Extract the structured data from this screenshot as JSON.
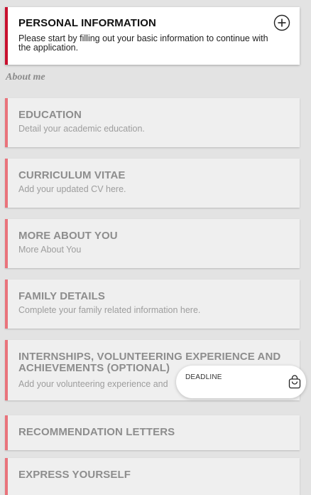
{
  "personal_info": {
    "title": "PERSONAL INFORMATION",
    "description": "Please start by filling out your basic information to continue with the application.",
    "expand_icon": "plus-circle-icon"
  },
  "section_label": "About me",
  "sections": [
    {
      "title": "EDUCATION",
      "description": "Detail your academic education."
    },
    {
      "title": "CURRICULUM VITAE",
      "description": "Add your updated CV here."
    },
    {
      "title": "MORE ABOUT YOU",
      "description": "More About You"
    },
    {
      "title": "FAMILY DETAILS",
      "description": "Complete your family related information here."
    },
    {
      "title": "INTERNSHIPS, VOLUNTEERING EXPERIENCE AND ACHIEVEMENTS (OPTIONAL)",
      "description": "Add your volunteering experience and"
    },
    {
      "title": "RECOMMENDATION LETTERS"
    },
    {
      "title": "EXPRESS YOURSELF"
    }
  ],
  "deadline": {
    "label": "DEADLINE",
    "icon": "shopping-bag-icon"
  },
  "colors": {
    "accent_red": "#c8102e",
    "inactive_border": "#e9737b",
    "page_background": "#e3e3e3"
  }
}
